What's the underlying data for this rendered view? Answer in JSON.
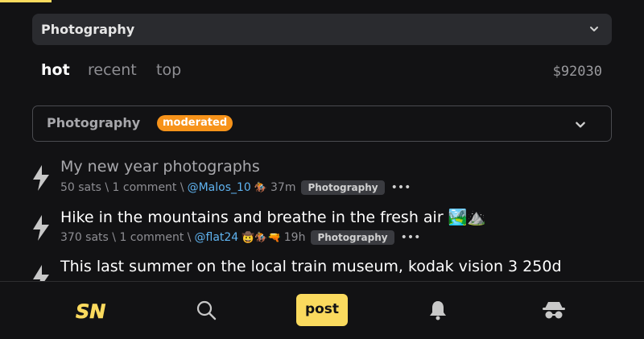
{
  "header": {
    "subs_select": {
      "value": "Photography"
    },
    "sort_tabs": [
      {
        "label": "hot",
        "active": true
      },
      {
        "label": "recent",
        "active": false
      },
      {
        "label": "top",
        "active": false
      }
    ],
    "price": "$92030"
  },
  "sub_header": {
    "name": "Photography",
    "badge": "moderated"
  },
  "items": [
    {
      "title": "My new year photographs",
      "sats": "50 sats",
      "comments": "1 comment",
      "user": "@Malos_10",
      "hats": "🏇",
      "age": "37m",
      "sub": "Photography",
      "menu": "•••"
    },
    {
      "title": "Hike in the mountains and breathe in the fresh air 🏞️⛰️",
      "sats": "370 sats",
      "comments": "1 comment",
      "user": "@flat24",
      "hats": "🤠🏇🔫",
      "age": "19h",
      "sub": "Photography",
      "menu": "•••"
    },
    {
      "title": "This last summer on the local train museum, kodak vision 3 250d"
    }
  ],
  "bottom_nav": {
    "logo": "SN",
    "post_label": "post",
    "icons": [
      "search-icon",
      "bell-icon",
      "anon-icon"
    ]
  },
  "colors": {
    "accent": "#fada5e",
    "moderated_badge": "#f7931a",
    "username": "#5fb3f0",
    "background": "#121214"
  }
}
